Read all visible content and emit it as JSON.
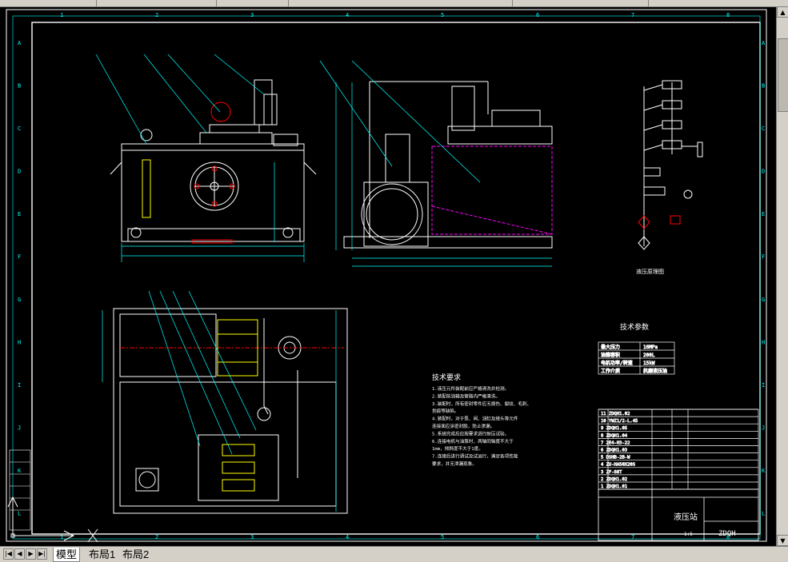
{
  "window": {
    "top_fields": [
      "",
      "",
      "",
      "",
      ""
    ]
  },
  "drawing": {
    "column_labels": [
      "1",
      "2",
      "3",
      "4",
      "5",
      "6",
      "7",
      "8"
    ],
    "row_labels": [
      "A",
      "B",
      "C",
      "D",
      "E",
      "F",
      "G",
      "H",
      "I",
      "J",
      "K",
      "L"
    ],
    "schematic_caption": "液压原理图",
    "tech_params": {
      "title": "技术参数",
      "rows": [
        [
          "最大压力",
          "16MPa"
        ],
        [
          "油箱容积",
          "200L"
        ],
        [
          "电机功率/转速",
          "15kW"
        ],
        [
          "工作介质",
          "抗磨液压油"
        ]
      ]
    },
    "tech_requirements": {
      "title": "技术要求",
      "items": [
        "1.液压元件装配前应严格清洗并检测。",
        "2.装配前油箱及管路内严格清洗。",
        "3.装配时，所有密封零件应无损伤、裂纹、毛刺、",
        "  划痕等缺陷。",
        "4.装配时，对于泵、阀、油缸及接头等元件",
        "  连接面应涂密封胶，防止渗漏。",
        "5.系统完成后应按要求进行耐压试验。",
        "6.连接电机与油泵时，两轴同轴度不大于",
        "  1mm，倾斜度不大于1度。",
        "7.连接后进行调试及试运行，满足各项性能",
        "  要求，并无泄漏现象。"
      ]
    },
    "bom_rows": [
      "11 ZDQH1.02",
      "10 YWZ1/2-L.45",
      "9 ZDQH1.05",
      "8 ZDQH1.04",
      "7 2E4-H3-22",
      "6 ZDQH1.03",
      "5 DSHB-2B-W",
      "4 ZU-HA50X20S",
      "3 ZF-88T",
      "2 ZDQH1.02",
      "1 ZDQH1.01"
    ],
    "title_block": {
      "main_title": "液压站",
      "drawing_no": "ZDQH",
      "company": "",
      "scale": "1:5"
    }
  },
  "status": {
    "tabs": [
      "模型",
      "布局1",
      "布局2"
    ],
    "active_tab": 0,
    "nav_buttons": [
      "|◀",
      "◀",
      "▶",
      "▶|"
    ]
  },
  "colors": {
    "background": "#000000",
    "frame": "#ffffff",
    "grid_text": "#00ffff",
    "machine_lines": "#ffffff",
    "dimension": "#00ffff",
    "hidden_outline": "#ff00ff",
    "valve_parts": "#ffff00",
    "pipes": "#ff0000",
    "ui_chrome": "#d4d0c8"
  }
}
